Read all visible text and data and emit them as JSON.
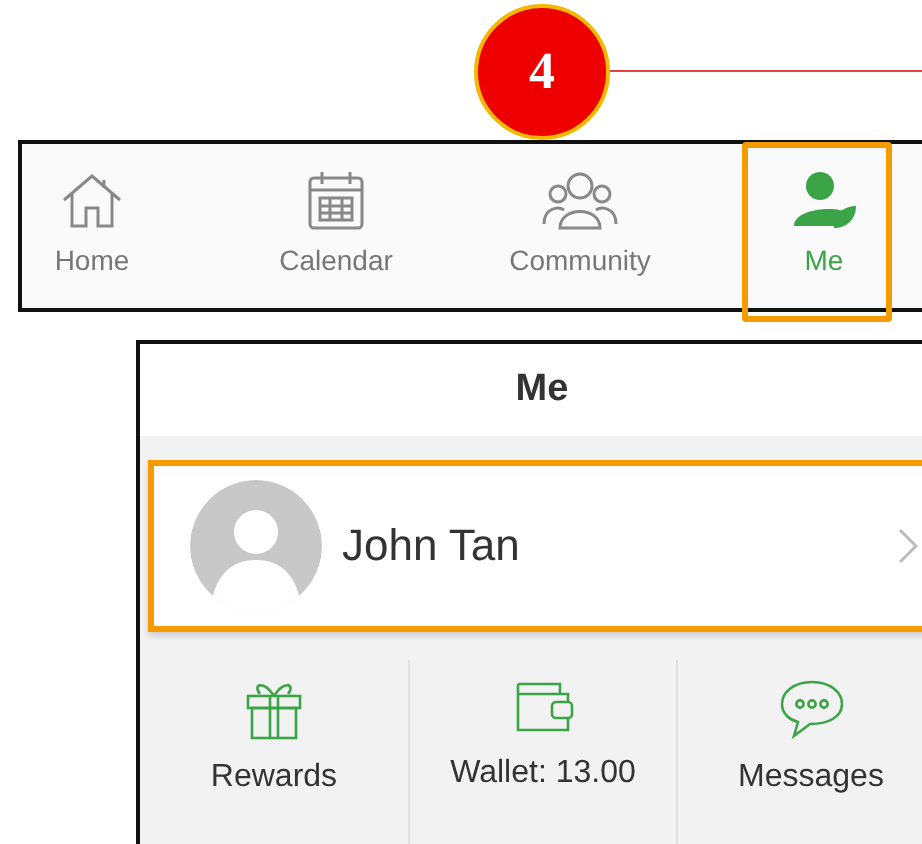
{
  "callout": {
    "number": "4"
  },
  "tab_bar": {
    "tabs": [
      {
        "label": "Home",
        "kind": "home",
        "selected": false,
        "highlighted": false
      },
      {
        "label": "Calendar",
        "kind": "calendar",
        "selected": false,
        "highlighted": false
      },
      {
        "label": "Community",
        "kind": "community",
        "selected": false,
        "highlighted": false
      },
      {
        "label": "Me",
        "kind": "me",
        "selected": true,
        "highlighted": true
      }
    ]
  },
  "me_screen": {
    "title": "Me",
    "profile": {
      "name": "John Tan",
      "highlighted": true
    },
    "shortcuts": [
      {
        "label": "Rewards",
        "kind": "rewards"
      },
      {
        "label": "Wallet: 13.00",
        "kind": "wallet"
      },
      {
        "label": "Messages",
        "kind": "messages"
      }
    ]
  }
}
